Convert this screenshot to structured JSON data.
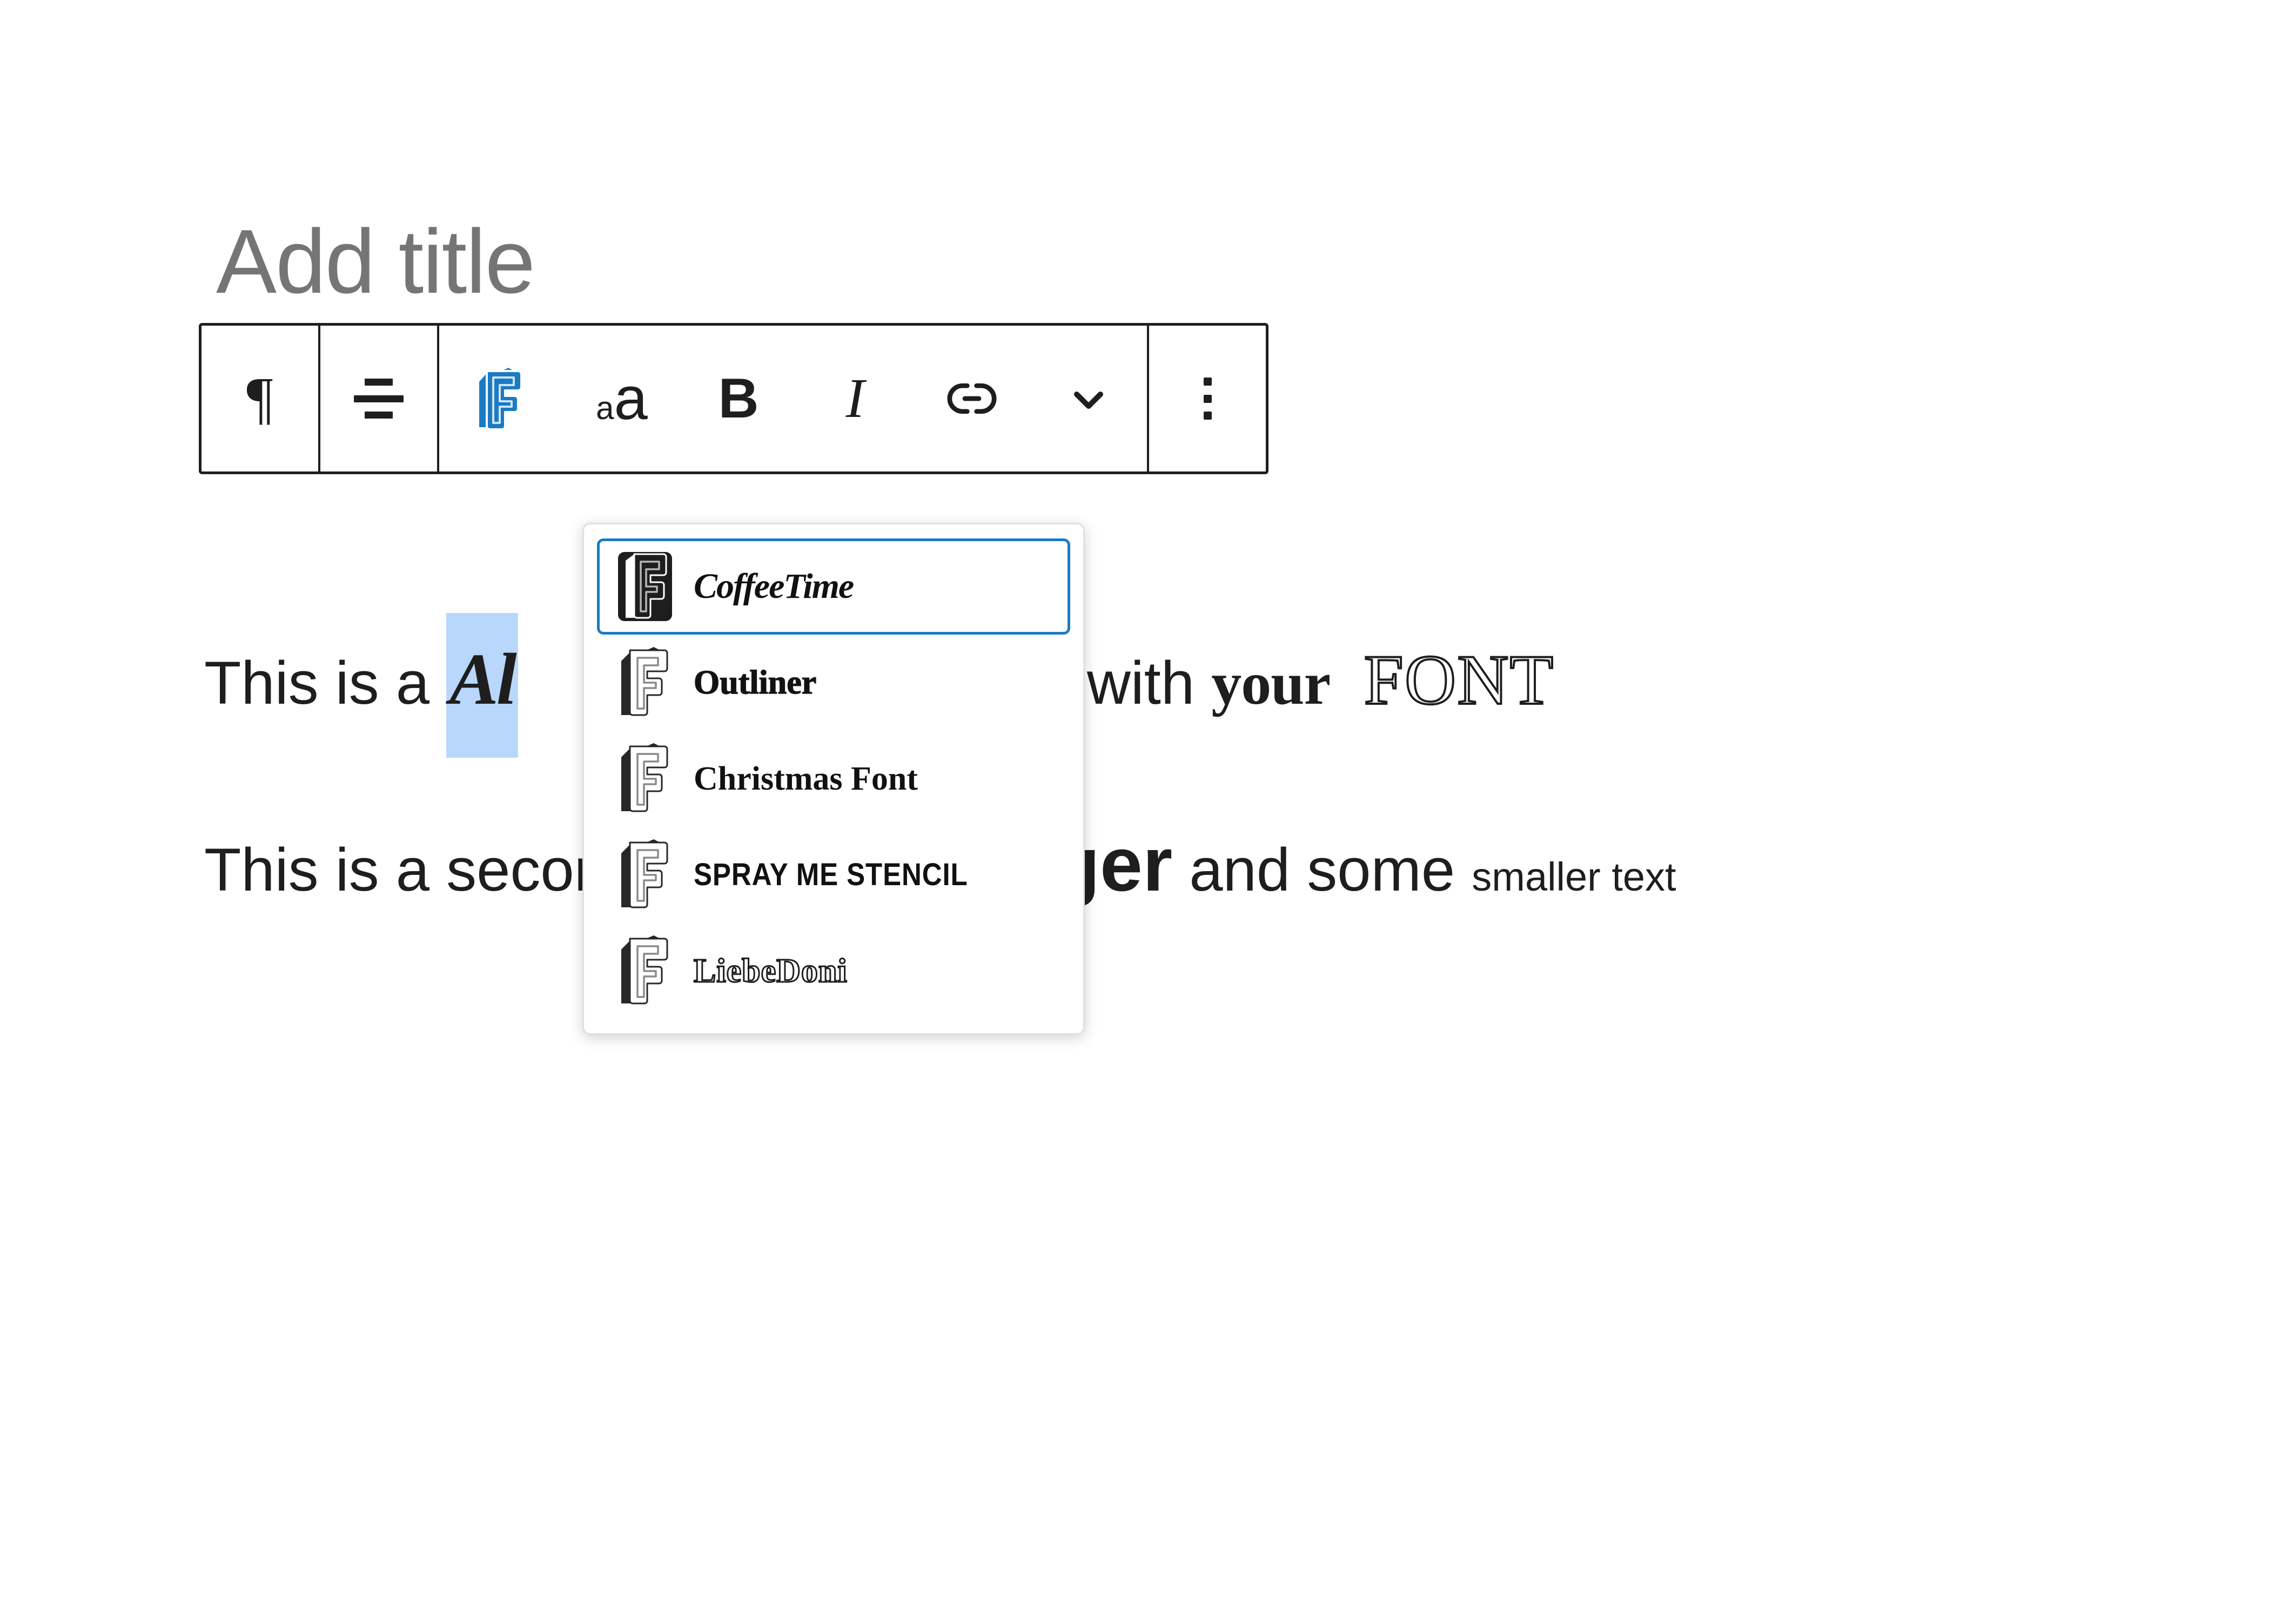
{
  "editor": {
    "title_placeholder": "Add title"
  },
  "toolbar": {
    "buttons": [
      {
        "name": "block-type",
        "icon": "pilcrow-icon",
        "label": "¶"
      },
      {
        "name": "align-text",
        "icon": "align-center-icon",
        "label": ""
      },
      {
        "name": "font-picker",
        "icon": "font-f-icon",
        "label": ""
      },
      {
        "name": "font-size",
        "icon": "text-size-icon",
        "label": "aA"
      },
      {
        "name": "bold",
        "icon": "bold-icon",
        "label": "B"
      },
      {
        "name": "italic",
        "icon": "italic-icon",
        "label": "I"
      },
      {
        "name": "link",
        "icon": "link-icon",
        "label": ""
      },
      {
        "name": "more-formatting",
        "icon": "chevron-down-icon",
        "label": ""
      },
      {
        "name": "block-options",
        "icon": "kebab-menu-icon",
        "label": ""
      }
    ]
  },
  "font_dropdown": {
    "options": [
      {
        "label": "CoffeeTime",
        "style": "style-coffeetime",
        "selected": true
      },
      {
        "label": "Outliner",
        "style": "style-outliner",
        "selected": false
      },
      {
        "label": "Christmas Font",
        "style": "style-christmas",
        "selected": false
      },
      {
        "label": "SPRAY ME STENCIL",
        "style": "style-stencil",
        "selected": false
      },
      {
        "label": "LiebeDoni",
        "style": "style-liebedoni",
        "selected": false
      }
    ]
  },
  "content": {
    "paragraph_1": {
      "lead": "This is a ",
      "selected_run": "Al",
      "mid": "paragraph text with ",
      "your": "your",
      "font": "FONT"
    },
    "paragraph_2": {
      "lead": "This is a secon",
      "larger": "arger",
      "mid": " and some ",
      "smaller": "smaller text"
    }
  },
  "colors": {
    "accent_blue": "#1a7bc4",
    "selection_highlight": "#b8d7fb",
    "toolbar_border": "#1e1e1e",
    "placeholder_gray": "#757575"
  }
}
